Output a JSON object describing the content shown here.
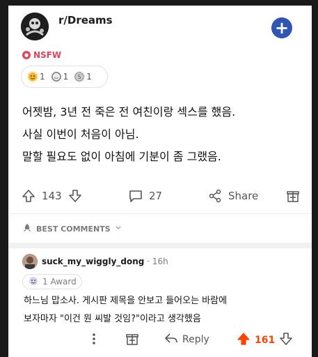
{
  "header": {
    "subreddit": "r/Dreams",
    "join_symbol": "+",
    "avatar_icon": "subreddit-avatar-icon"
  },
  "tags": {
    "nsfw": "NSFW"
  },
  "awards": [
    {
      "icon": "wholesome-award-icon",
      "count": "1",
      "color": "#f2b72f"
    },
    {
      "icon": "laughing-award-icon",
      "count": "1",
      "color": "#7a7a7a"
    },
    {
      "icon": "silver-award-icon",
      "count": "1",
      "color": "#8a8a8a"
    }
  ],
  "post": {
    "lines": [
      "어젯밤, 3년 전 죽은 전 여친이랑 섹스를 했음.",
      "사실 이번이 처음이 아님.",
      "말할 필요도 없이 아침에 기분이 좀 그랬음."
    ]
  },
  "actions": {
    "upvotes": "143",
    "comments": "27",
    "share": "Share"
  },
  "comments_header": {
    "sort_label": "BEST COMMENTS"
  },
  "comment": {
    "user": "suck_my_wiggly_dong",
    "time": " · 16h",
    "award_label": "1 Award",
    "lines": [
      "하느님 맙소사. 게시판 제목을 안보고 들어오는 바람에",
      "보자마자 \"이건 뭔 씨발 것임?\"이라고 생각했음"
    ],
    "reply": "Reply",
    "score": "161"
  },
  "colors": {
    "accent": "#2f56b5",
    "nsfw": "#e0465b",
    "upvote_active": "#ff4500"
  }
}
